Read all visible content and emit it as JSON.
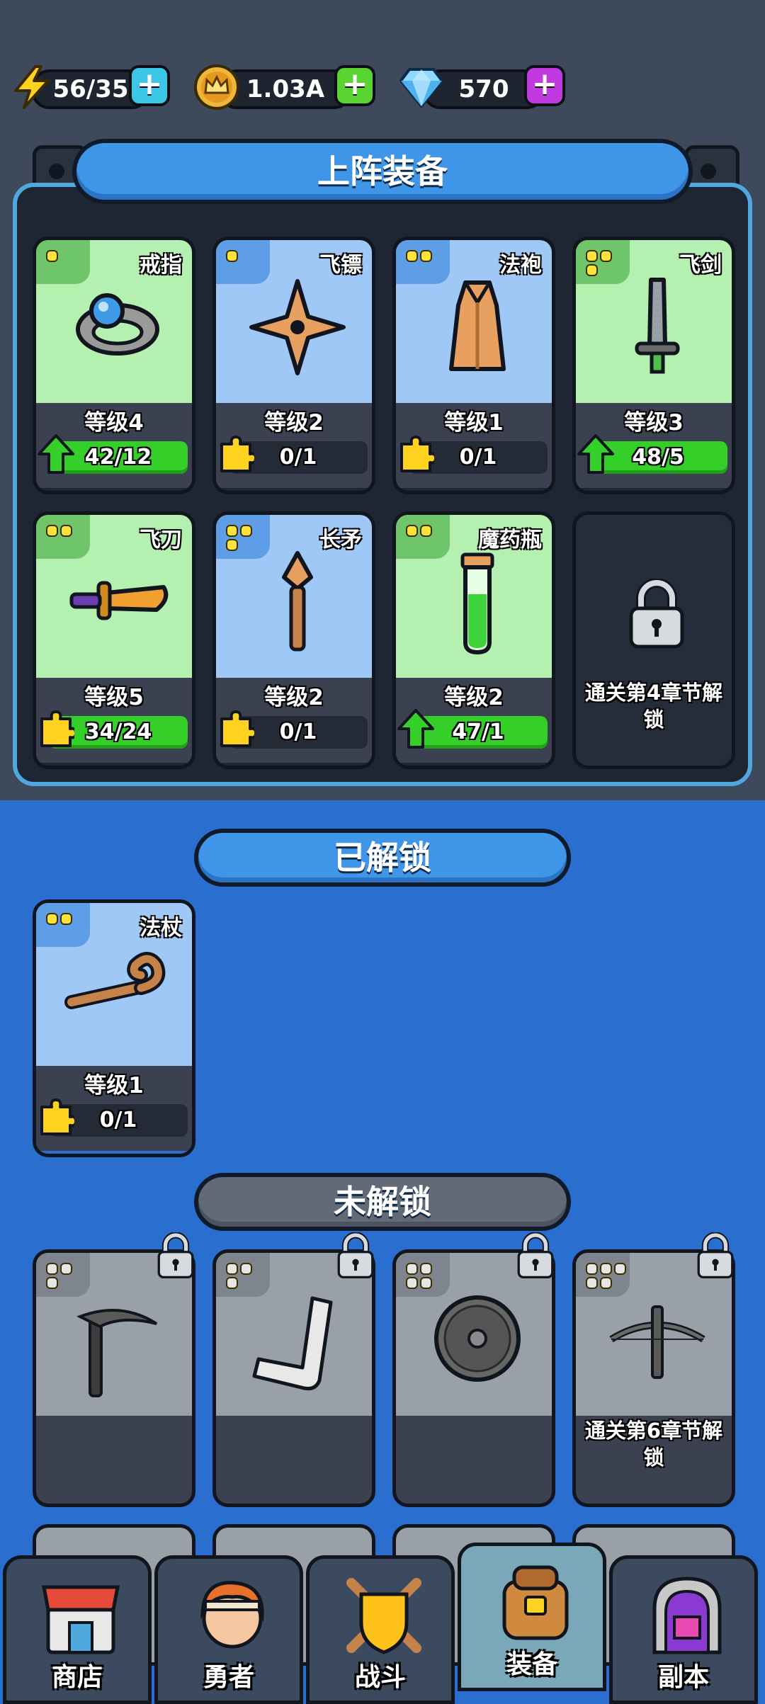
{
  "resources": {
    "energy": "56/35",
    "gold": "1.03A",
    "gems": "570"
  },
  "sections": {
    "equipped_title": "上阵装备",
    "unlocked_title": "已解锁",
    "locked_title": "未解锁"
  },
  "equipped": [
    {
      "name": "戒指",
      "level": "等级4",
      "progress": "42/12",
      "theme": "green",
      "tier": 1,
      "icon": "ring-icon",
      "upgradable": true,
      "fill": 1.0
    },
    {
      "name": "飞镖",
      "level": "等级2",
      "progress": "0/1",
      "theme": "blue",
      "tier": 1,
      "icon": "shuriken-icon",
      "upgradable": false,
      "fill": 0.0
    },
    {
      "name": "法袍",
      "level": "等级1",
      "progress": "0/1",
      "theme": "blue",
      "tier": 2,
      "icon": "robe-icon",
      "upgradable": false,
      "fill": 0.0
    },
    {
      "name": "飞剑",
      "level": "等级3",
      "progress": "48/5",
      "theme": "green",
      "tier": 3,
      "icon": "sword-icon",
      "upgradable": true,
      "fill": 1.0
    },
    {
      "name": "飞刀",
      "level": "等级5",
      "progress": "34/24",
      "theme": "green",
      "tier": 2,
      "icon": "dagger-icon",
      "upgradable": false,
      "fill": 1.0
    },
    {
      "name": "长矛",
      "level": "等级2",
      "progress": "0/1",
      "theme": "blue",
      "tier": 3,
      "icon": "spear-icon",
      "upgradable": false,
      "fill": 0.0
    },
    {
      "name": "魔药瓶",
      "level": "等级2",
      "progress": "47/1",
      "theme": "green",
      "tier": 2,
      "icon": "potion-icon",
      "upgradable": true,
      "fill": 1.0
    }
  ],
  "equipped_locked_slot": "通关第4章节解锁",
  "unlocked": [
    {
      "name": "法杖",
      "level": "等级1",
      "progress": "0/1",
      "theme": "blue",
      "tier": 2,
      "icon": "staff-icon",
      "fill": 0.0
    }
  ],
  "locked_unlock_text": "通关第6章节解锁",
  "nav": [
    {
      "label": "商店",
      "icon": "shop-icon",
      "active": false
    },
    {
      "label": "勇者",
      "icon": "hero-icon",
      "active": false
    },
    {
      "label": "战斗",
      "icon": "battle-icon",
      "active": false
    },
    {
      "label": "装备",
      "icon": "backpack-icon",
      "active": true
    },
    {
      "label": "副本",
      "icon": "dungeon-icon",
      "active": false
    }
  ],
  "colors": {
    "energy_plus": "#3cc6e8",
    "gold_plus": "#5ad431",
    "gem_plus": "#c13ae0",
    "progress_fill": "#35cf2a"
  }
}
